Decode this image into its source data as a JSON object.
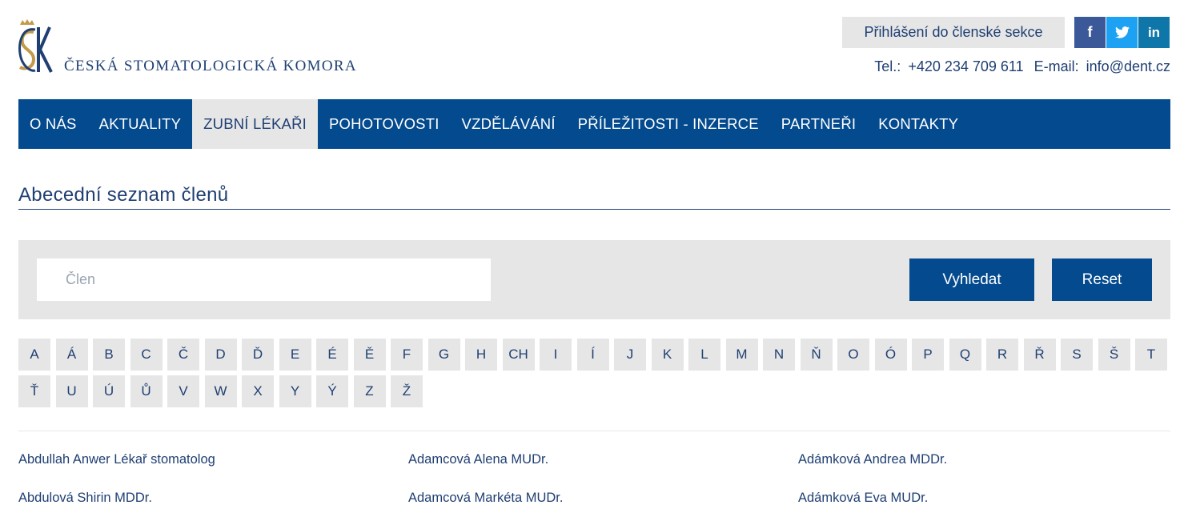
{
  "header": {
    "logo_text": "ČESKÁ STOMATOLOGICKÁ KOMORA",
    "login_label": "Přihlášení do členské sekce",
    "social": [
      {
        "name": "facebook-icon",
        "glyph": "f",
        "color": "#3b5998"
      },
      {
        "name": "twitter-icon",
        "glyph": "🐦",
        "color": "#1da1f2"
      },
      {
        "name": "linkedin-icon",
        "glyph": "in",
        "color": "#0e76a8"
      }
    ],
    "tel_label": "Tel.:",
    "tel_value": "+420 234 709 611",
    "email_label": "E-mail:",
    "email_value": "info@dent.cz"
  },
  "nav": {
    "items": [
      {
        "label": "O NÁS"
      },
      {
        "label": "AKTUALITY"
      },
      {
        "label": "ZUBNÍ LÉKAŘI",
        "active": true
      },
      {
        "label": "POHOTOVOSTI"
      },
      {
        "label": "VZDĚLÁVÁNÍ"
      },
      {
        "label": "PŘÍLEŽITOSTI - INZERCE"
      },
      {
        "label": "PARTNEŘI"
      },
      {
        "label": "KONTAKTY"
      }
    ]
  },
  "main": {
    "title": "Abecední seznam členů",
    "search": {
      "placeholder": "Člen",
      "value": "",
      "search_label": "Vyhledat",
      "reset_label": "Reset"
    },
    "letters": [
      "A",
      "Á",
      "B",
      "C",
      "Č",
      "D",
      "Ď",
      "E",
      "É",
      "Ě",
      "F",
      "G",
      "H",
      "CH",
      "I",
      "Í",
      "J",
      "K",
      "L",
      "M",
      "N",
      "Ň",
      "O",
      "Ó",
      "P",
      "Q",
      "R",
      "Ř",
      "S",
      "Š",
      "T",
      "Ť",
      "U",
      "Ú",
      "Ů",
      "V",
      "W",
      "X",
      "Y",
      "Ý",
      "Z",
      "Ž"
    ],
    "members": [
      "Abdullah Anwer Lékař stomatolog",
      "Adamcová Alena MUDr.",
      "Adámková Andrea MDDr.",
      "Abdulová Shirin MDDr.",
      "Adamcová Markéta MUDr.",
      "Adámková Eva MUDr."
    ]
  },
  "colors": {
    "brand": "#044a8e",
    "text": "#1f3f73",
    "panel": "#e6e6e6"
  }
}
